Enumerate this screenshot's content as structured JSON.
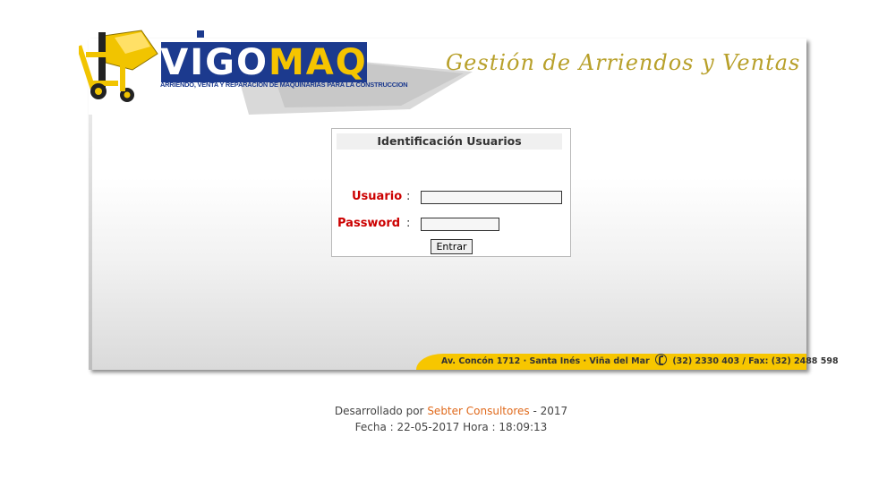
{
  "brand": {
    "logo_part1": "VIGO",
    "logo_part2": "MAQ",
    "tagline": "ARRIENDO, VENTA Y REPARACION DE MAQUINARIAS PARA LA CONSTRUCCION",
    "app_title": "Gestión de Arriendos y Ventas",
    "colors": {
      "logo_blue": "#1c3a8e",
      "logo_yellow": "#f5c400",
      "title_gold": "#b8a02a",
      "bar_yellow": "#f7c600"
    }
  },
  "login": {
    "heading": "Identificación Usuarios",
    "user_label": "Usuario",
    "password_label": "Password",
    "colon": ":",
    "user_value": "",
    "password_value": "",
    "submit_label": "Entrar",
    "label_color": "#cc0000"
  },
  "address_bar": {
    "address": "Av. Concón 1712 · Santa Inés · Viña del Mar",
    "phones": "(32) 2330 403 / Fax: (32) 2488 598",
    "icon": "phone-icon"
  },
  "footer": {
    "developed_by_prefix": "Desarrollado por",
    "company_link": "Sebter Consultores",
    "developed_by_suffix": "- 2017",
    "date_line": "Fecha : 22-05-2017 Hora : 18:09:13"
  }
}
